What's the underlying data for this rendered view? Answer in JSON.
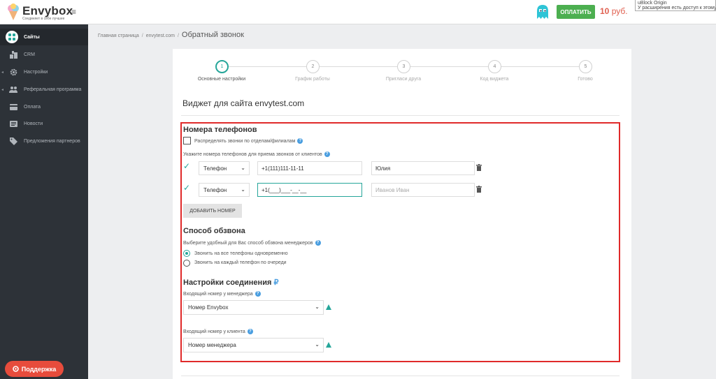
{
  "header": {
    "brand": "Envybox",
    "tagline": "Соединяет в себе лучшее",
    "pay_label": "ОПЛАТИТЬ",
    "balance_value": "10",
    "balance_unit": "руб.",
    "ublock_line1": "uBlock Origin",
    "ublock_line2": "У расширения есть доступ к этому са",
    "colors": {
      "pay": "#4caf50",
      "balance": "#e06050"
    }
  },
  "sidebar": {
    "items": [
      {
        "label": "Сайты",
        "icon": "sites-icon"
      },
      {
        "label": "CRM",
        "icon": "crm-icon"
      },
      {
        "label": "Настройки",
        "icon": "gear-icon"
      },
      {
        "label": "Реферальная программа",
        "icon": "users-icon"
      },
      {
        "label": "Оплата",
        "icon": "card-icon"
      },
      {
        "label": "Новости",
        "icon": "news-icon"
      },
      {
        "label": "Предложения партнеров",
        "icon": "tag-icon"
      }
    ],
    "support_label": "Поддержка"
  },
  "breadcrumb": {
    "home": "Главная страница",
    "site": "envytest.com",
    "current": "Обратный звонок"
  },
  "steps": [
    {
      "num": "1",
      "label": "Основные настройки",
      "active": true
    },
    {
      "num": "2",
      "label": "График работы",
      "active": false
    },
    {
      "num": "3",
      "label": "Пригласи друга",
      "active": false
    },
    {
      "num": "4",
      "label": "Код виджета",
      "active": false
    },
    {
      "num": "5",
      "label": "Готово",
      "active": false
    }
  ],
  "widget_title": "Виджет для сайта envytest.com",
  "phones": {
    "title": "Номера телефонов",
    "distribute_label": "Распределять звонки по отделам/филиалам",
    "hint": "Укажите номера телефонов для приема звонков от клиентов",
    "rows": [
      {
        "type": "Телефон",
        "number": "+1(111)111-11-11",
        "name": "Юлия",
        "name_placeholder": ""
      },
      {
        "type": "Телефон",
        "number": "+1(___)___-__-__",
        "name": "",
        "name_placeholder": "Иванов Иван"
      }
    ],
    "add_label": "ДОБАВИТЬ НОМЕР"
  },
  "dial": {
    "title": "Способ обзвона",
    "hint": "Выберите удобный для Вас способ обзвона менеджеров",
    "options": [
      "Звонить на все телефоны одновременно",
      "Звонить на каждый телефон по очереди"
    ],
    "selected": 0
  },
  "connection": {
    "title": "Настройки соединения",
    "currency_symbol": "₽",
    "manager_label": "Входящий номер у менеджера",
    "manager_value": "Номер Envybox",
    "client_label": "Входящий номер у клиента",
    "client_value": "Номер менеджера"
  },
  "accent": "#26a69a",
  "highlight": "#e02a2a"
}
